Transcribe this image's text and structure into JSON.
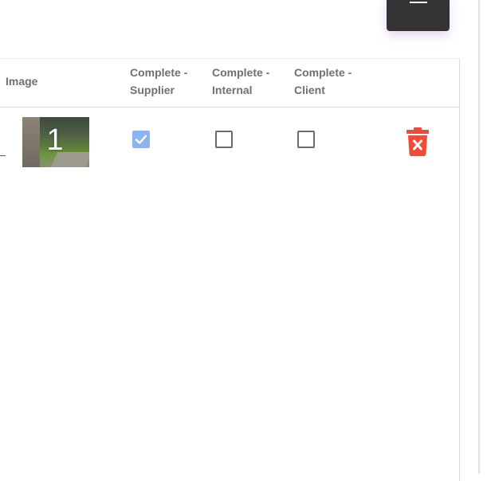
{
  "table": {
    "columns": {
      "image": "Image",
      "complete_supplier_line1": "Complete -",
      "complete_supplier_line2": "Supplier",
      "complete_internal_line1": "Complete -",
      "complete_internal_line2": "Internal",
      "complete_client_line1": "Complete -",
      "complete_client_line2": "Client"
    },
    "rows": [
      {
        "image_number": "1",
        "complete_supplier": true,
        "complete_internal": false,
        "complete_client": false
      }
    ]
  },
  "icons": {
    "menu": "hamburger-icon",
    "delete": "trash-x-icon",
    "check": "checkmark-icon"
  },
  "colors": {
    "menu_bg": "#333333",
    "checkbox_checked": "#8cb4f5",
    "delete_red": "#f04b36"
  }
}
